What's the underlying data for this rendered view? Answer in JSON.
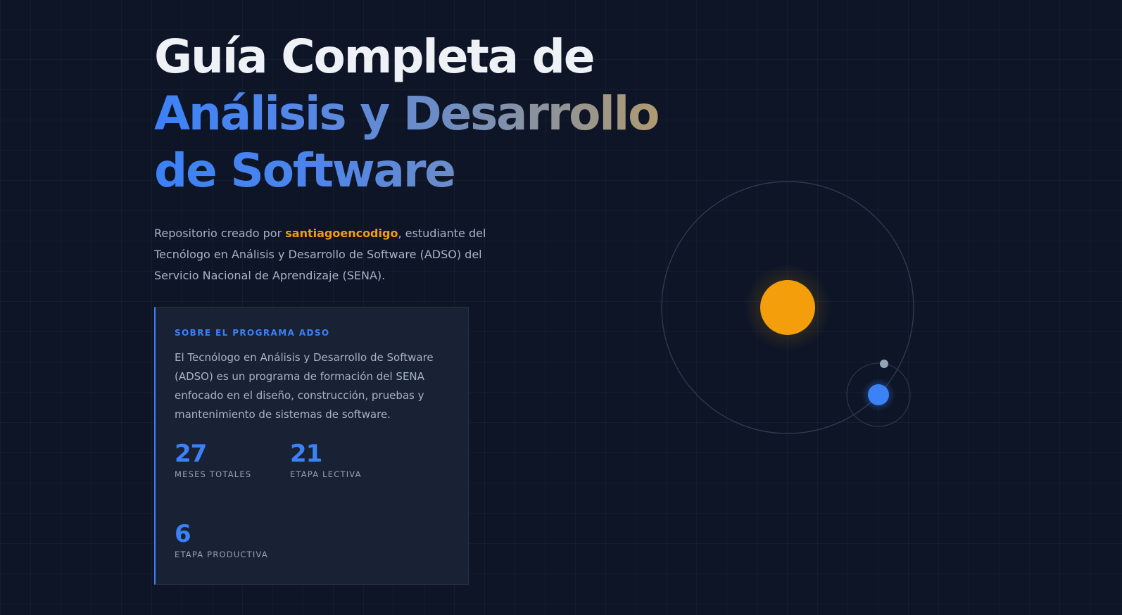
{
  "hero": {
    "title_line1": "Guía Completa de",
    "title_line2": "Análisis y Desarrollo",
    "title_line3": "de Software",
    "intro_prefix": "Repositorio creado por ",
    "author": "santiagoencodigo",
    "intro_suffix": ", estudiante del Tecnólogo en Análisis y Desarrollo de Software (ADSO) del Servicio Nacional de Aprendizaje (SENA)."
  },
  "program_card": {
    "label": "SOBRE EL PROGRAMA ADSO",
    "description": "El Tecnólogo en Análisis y Desarrollo de Software (ADSO) es un programa de formación del SENA enfocado en el diseño, construcción, pruebas y mantenimiento de sistemas de software.",
    "stats": [
      {
        "value": "27",
        "label": "MESES TOTALES"
      },
      {
        "value": "21",
        "label": "ETAPA LECTIVA"
      },
      {
        "value": "6",
        "label": "ETAPA PRODUCTIVA"
      }
    ]
  },
  "colors": {
    "background": "#0d1526",
    "accent_blue": "#3b82f6",
    "accent_orange": "#f59e0b",
    "card_background": "#182234",
    "muted_text": "#a7b3c6"
  },
  "icons": {
    "sun": "sun-icon",
    "planet": "planet-icon",
    "moon": "moon-icon"
  }
}
